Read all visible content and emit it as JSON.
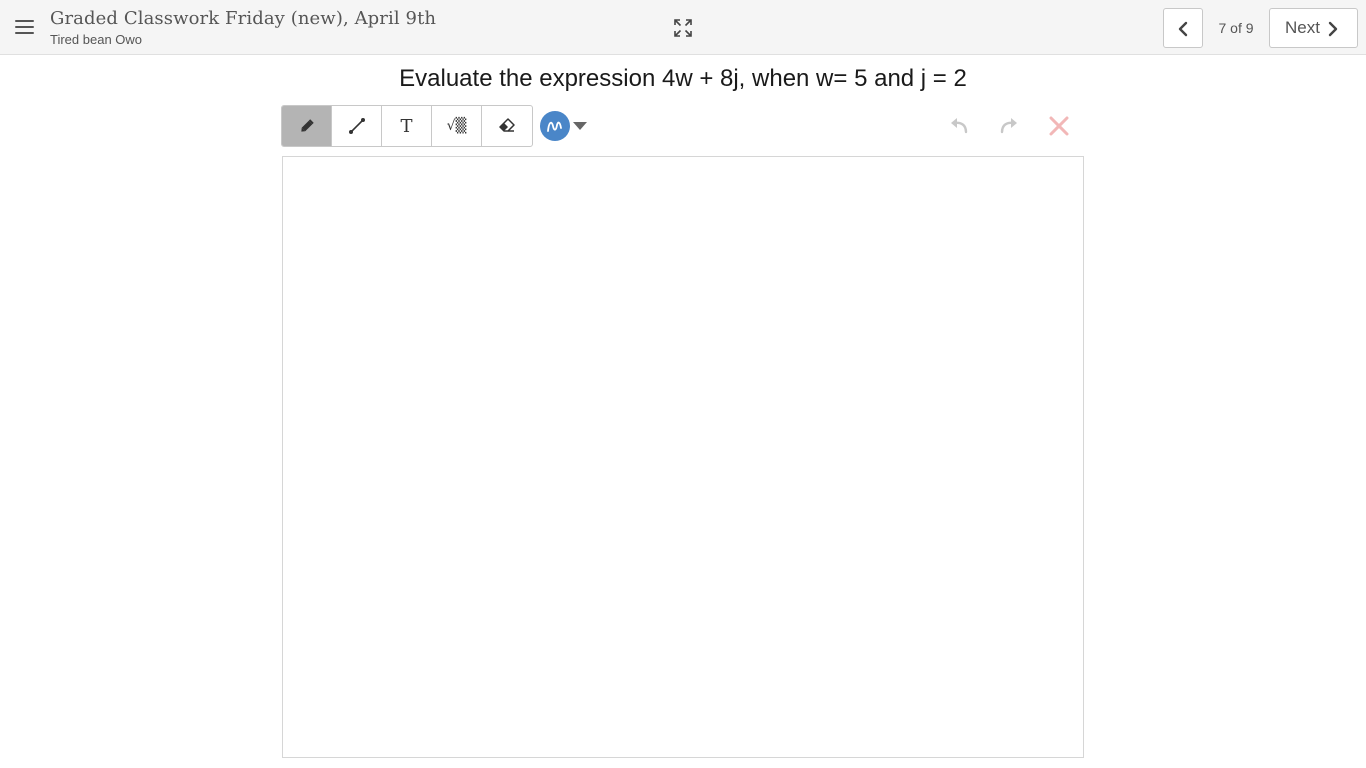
{
  "header": {
    "title": "Graded Classwork Friday (new), April 9th",
    "subtitle": "Tired bean Owo",
    "counter": "7 of 9",
    "next_label": "Next"
  },
  "question": {
    "text": "Evaluate the expression 4w + 8j, when w= 5 and j = 2"
  },
  "toolbar": {
    "tools": [
      {
        "name": "pencil",
        "icon": "pencil-icon",
        "active": true
      },
      {
        "name": "line",
        "icon": "line-icon",
        "active": false
      },
      {
        "name": "text",
        "icon": "text-icon",
        "glyph": "T",
        "active": false
      },
      {
        "name": "equation",
        "icon": "sqrt-icon",
        "glyph": "√▒",
        "active": false
      },
      {
        "name": "eraser",
        "icon": "eraser-icon",
        "active": false
      }
    ],
    "selected_color": "#4a86c8",
    "clear_color": "#f2b7b7",
    "undo_color": "#c8c8c8"
  }
}
